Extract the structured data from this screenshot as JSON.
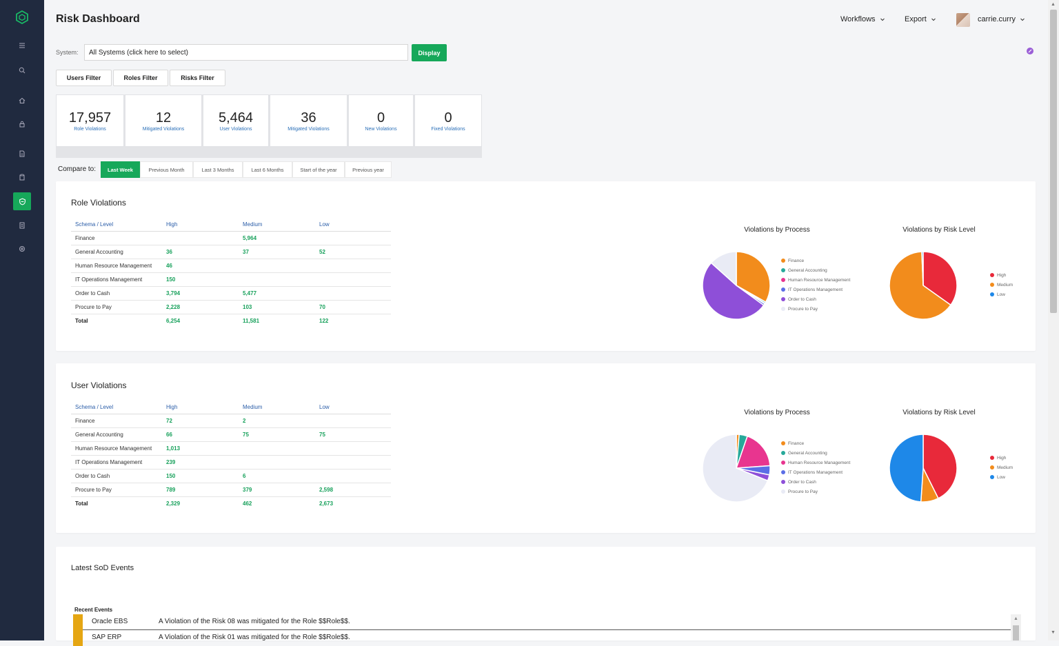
{
  "header": {
    "title": "Risk Dashboard",
    "workflows_label": "Workflows",
    "export_label": "Export",
    "user_name": "carrie.curry"
  },
  "system": {
    "label": "System:",
    "value": "All Systems (click here to select)",
    "display_button": "Display"
  },
  "filters": [
    "Users Filter",
    "Roles Filter",
    "Risks Filter"
  ],
  "stats": [
    {
      "value": "17,957",
      "label": "Role Violations"
    },
    {
      "value": "12",
      "label": "Mitigated Violations"
    },
    {
      "value": "5,464",
      "label": "User Violations"
    },
    {
      "value": "36",
      "label": "Mitigated Violations"
    },
    {
      "value": "0",
      "label": "New Violations"
    },
    {
      "value": "0",
      "label": "Fixed Violations"
    }
  ],
  "compare": {
    "label": "Compare to:",
    "options": [
      "Last Week",
      "Previous Month",
      "Last 3 Months",
      "Last 6 Months",
      "Start of the year",
      "Previous year"
    ],
    "active": "Last Week"
  },
  "role_violations": {
    "title": "Role Violations",
    "headers": [
      "Schema / Level",
      "High",
      "Medium",
      "Low"
    ],
    "rows": [
      [
        "Finance",
        "",
        "5,964",
        ""
      ],
      [
        "General Accounting",
        "36",
        "37",
        "52"
      ],
      [
        "Human Resource Management",
        "46",
        "",
        ""
      ],
      [
        "IT Operations Management",
        "150",
        "",
        ""
      ],
      [
        "Order to Cash",
        "3,794",
        "5,477",
        ""
      ],
      [
        "Procure to Pay",
        "2,228",
        "103",
        "70"
      ],
      [
        "Total",
        "6,254",
        "11,581",
        "122"
      ]
    ],
    "chart_process_title": "Violations by Process",
    "chart_risk_title": "Violations by Risk Level"
  },
  "user_violations": {
    "title": "User Violations",
    "headers": [
      "Schema / Level",
      "High",
      "Medium",
      "Low"
    ],
    "rows": [
      [
        "Finance",
        "72",
        "2",
        ""
      ],
      [
        "General Accounting",
        "66",
        "75",
        "75"
      ],
      [
        "Human Resource Management",
        "1,013",
        "",
        ""
      ],
      [
        "IT Operations Management",
        "239",
        "",
        ""
      ],
      [
        "Order to Cash",
        "150",
        "6",
        ""
      ],
      [
        "Procure to Pay",
        "789",
        "379",
        "2,598"
      ],
      [
        "Total",
        "2,329",
        "462",
        "2,673"
      ]
    ],
    "chart_process_title": "Violations by Process",
    "chart_risk_title": "Violations by Risk Level"
  },
  "process_legend": [
    {
      "label": "Finance",
      "color": "#f28c1c"
    },
    {
      "label": "General Accounting",
      "color": "#27a99a"
    },
    {
      "label": "Human Resource Management",
      "color": "#e8358f"
    },
    {
      "label": "IT Operations Management",
      "color": "#5b6ee6"
    },
    {
      "label": "Order to Cash",
      "color": "#8e4fd8"
    },
    {
      "label": "Procure to Pay",
      "color": "#e9ebf5"
    }
  ],
  "risk_legend": [
    {
      "label": "High",
      "color": "#e8293a"
    },
    {
      "label": "Medium",
      "color": "#f28c1c"
    },
    {
      "label": "Low",
      "color": "#1e88e8"
    }
  ],
  "role_process_values": [
    5964,
    125,
    46,
    150,
    9271,
    2401
  ],
  "role_risk_values": [
    6254,
    11581,
    122
  ],
  "user_process_values": [
    74,
    216,
    1013,
    239,
    156,
    3766
  ],
  "user_risk_values": [
    2329,
    462,
    2673
  ],
  "events": {
    "title": "Latest SoD Events",
    "recent_label": "Recent Events",
    "items": [
      {
        "system": "Oracle EBS",
        "text": "A Violation of the Risk 08 was mitigated for the Role $$Role$$."
      },
      {
        "system": "SAP ERP",
        "text": "A Violation of the Risk 01 was mitigated for the Role $$Role$$."
      }
    ]
  },
  "colors": {
    "accent": "#16a85a",
    "sidebar": "#202a3f"
  }
}
